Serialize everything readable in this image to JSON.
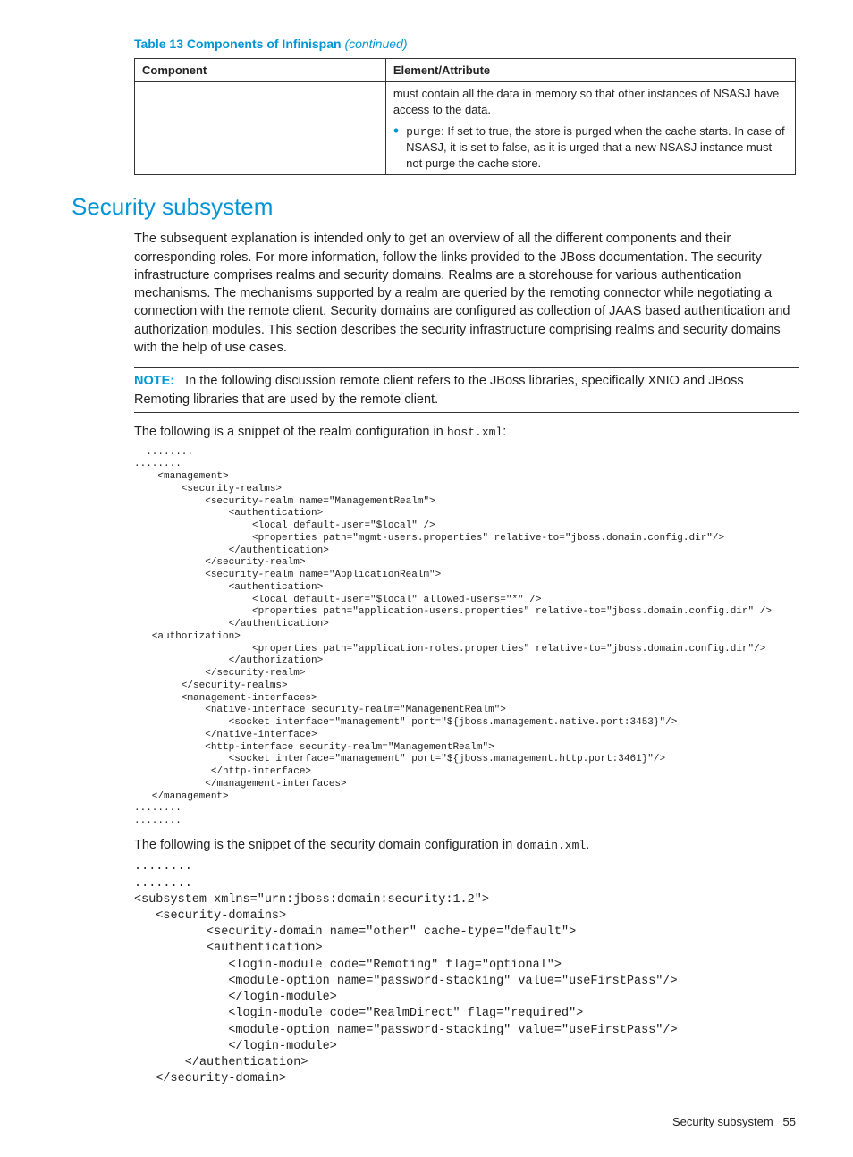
{
  "table": {
    "caption_strong": "Table 13 Components of Infinispan",
    "caption_cont": "(continued)",
    "header_col1": "Component",
    "header_col2": "Element/Attribute",
    "cell_para1": "must contain all the data in memory so that other instances of NSASJ have access to the data.",
    "bullet_code": "purge",
    "bullet_rest": ": If set to true, the store is purged when the cache starts. In case of NSASJ, it is set to false, as it is urged that a new NSASJ instance must not purge the cache store."
  },
  "section_title": "Security subsystem",
  "para1": "The subsequent explanation is intended only to get an overview of all the different components and their corresponding roles. For more information, follow the links provided to the JBoss documentation. The security infrastructure comprises realms and security domains. Realms are a storehouse for various authentication mechanisms. The mechanisms supported by a realm are queried by the remoting connector while negotiating a connection with the remote client. Security domains are configured as collection of JAAS based authentication and authorization modules. This section describes the security infrastructure comprising realms and security domains with the help of use cases.",
  "note_label": "NOTE:",
  "note_text": "In the following discussion remote client refers to the JBoss libraries, specifically XNIO and JBoss Remoting libraries that are used by the remote client.",
  "intro1_pre": "The following is a snippet of the realm configuration in ",
  "intro1_mono": "host.xml",
  "intro1_post": ":",
  "code1": "  ........\n........\n    <management>\n        <security-realms>\n            <security-realm name=\"ManagementRealm\">\n                <authentication>\n                    <local default-user=\"$local\" />\n                    <properties path=\"mgmt-users.properties\" relative-to=\"jboss.domain.config.dir\"/>\n                </authentication>\n            </security-realm>\n            <security-realm name=\"ApplicationRealm\">\n                <authentication>\n                    <local default-user=\"$local\" allowed-users=\"*\" />\n                    <properties path=\"application-users.properties\" relative-to=\"jboss.domain.config.dir\" />\n                </authentication>\n   <authorization>\n                    <properties path=\"application-roles.properties\" relative-to=\"jboss.domain.config.dir\"/>\n                </authorization>\n            </security-realm>\n        </security-realms>\n        <management-interfaces>\n            <native-interface security-realm=\"ManagementRealm\">\n                <socket interface=\"management\" port=\"${jboss.management.native.port:3453}\"/>\n            </native-interface>\n            <http-interface security-realm=\"ManagementRealm\">\n                <socket interface=\"management\" port=\"${jboss.management.http.port:3461}\"/>\n             </http-interface>\n            </management-interfaces>\n   </management>\n........\n........",
  "intro2_pre": "The following is the snippet of the security domain configuration in ",
  "intro2_mono": "domain.xml",
  "intro2_post": ".",
  "code2": "........\n........\n<subsystem xmlns=\"urn:jboss:domain:security:1.2\">\n   <security-domains>\n          <security-domain name=\"other\" cache-type=\"default\">\n          <authentication>\n             <login-module code=\"Remoting\" flag=\"optional\">\n             <module-option name=\"password-stacking\" value=\"useFirstPass\"/>\n             </login-module>\n             <login-module code=\"RealmDirect\" flag=\"required\">\n             <module-option name=\"password-stacking\" value=\"useFirstPass\"/>\n             </login-module>\n       </authentication>\n   </security-domain>",
  "footer_text": "Security subsystem",
  "footer_page": "55"
}
